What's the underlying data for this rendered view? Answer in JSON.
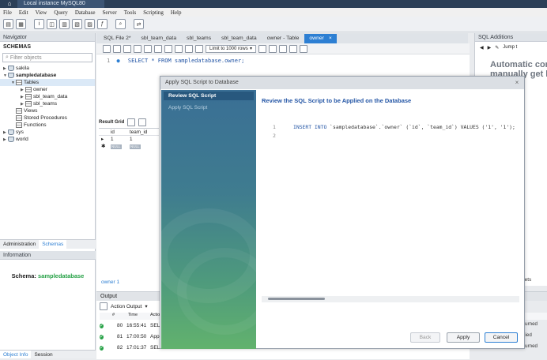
{
  "window": {
    "tab_title": "Local instance MySQL80"
  },
  "menu": [
    "File",
    "Edit",
    "View",
    "Query",
    "Database",
    "Server",
    "Tools",
    "Scripting",
    "Help"
  ],
  "navigator": {
    "header": "Navigator",
    "schemas_label": "SCHEMAS",
    "filter_placeholder": "Filter objects",
    "tree": {
      "sakila": "sakila",
      "sampledatabase": "sampledatabase",
      "tables": "Tables",
      "owner": "owner",
      "sbl_team_data": "sbl_team_data",
      "sbl_teams": "sbl_teams",
      "views": "Views",
      "procedures": "Stored Procedures",
      "functions": "Functions",
      "sys": "sys",
      "world": "world"
    },
    "tabs": {
      "administration": "Administration",
      "schemas": "Schemas"
    },
    "information_header": "Information",
    "schema_info_label": "Schema:",
    "schema_info_value": "sampledatabase",
    "bottom_tabs": {
      "object_info": "Object Info",
      "session": "Session"
    }
  },
  "editor": {
    "tabs": [
      "SQL File 2*",
      "sbl_team_data",
      "sbl_teams",
      "sbl_team_data",
      "owner - Table",
      "owner"
    ],
    "active_tab": "owner",
    "limit_label": "Limit to 1000 rows",
    "line1_num": "1",
    "line1_code": "SELECT * FROM sampledatabase.owner;",
    "result_grid_label": "Result Grid",
    "grid": {
      "columns": [
        "id",
        "team_id"
      ],
      "row1": [
        "1",
        "1"
      ],
      "row2": [
        "NULL",
        "NULL"
      ]
    },
    "result_tab": "owner 1"
  },
  "output": {
    "header": "Output",
    "mode": "Action Output",
    "columns": {
      "num": "#",
      "time": "Time",
      "action": "Actio"
    },
    "rows": [
      {
        "num": "80",
        "time": "16:55:41",
        "action": "SELE",
        "response": "(s) returned"
      },
      {
        "num": "81",
        "time": "17:00:50",
        "action": "Apply",
        "response": "s applied"
      },
      {
        "num": "82",
        "time": "17:01:37",
        "action": "SELE",
        "response": "(s) returned"
      }
    ]
  },
  "sql_additions": {
    "header": "SQL Additions",
    "jump_label": "Jump t",
    "help_line1": "Automatic cont",
    "help_line2": "manually get h",
    "snippets_label": "pets"
  },
  "dialog": {
    "title": "Apply SQL Script to Database",
    "step_active": "Review SQL Script",
    "step_next": "Apply SQL Script",
    "heading": "Review the SQL Script to be Applied on the Database",
    "line1_num": "1",
    "line2_num": "2",
    "insert_keyword": "INSERT INTO",
    "insert_rest": " `sampledatabase`.`owner` (`id`, `team_id`) VALUES ('1', '1');",
    "buttons": {
      "back": "Back",
      "apply": "Apply",
      "cancel": "Cancel"
    }
  }
}
